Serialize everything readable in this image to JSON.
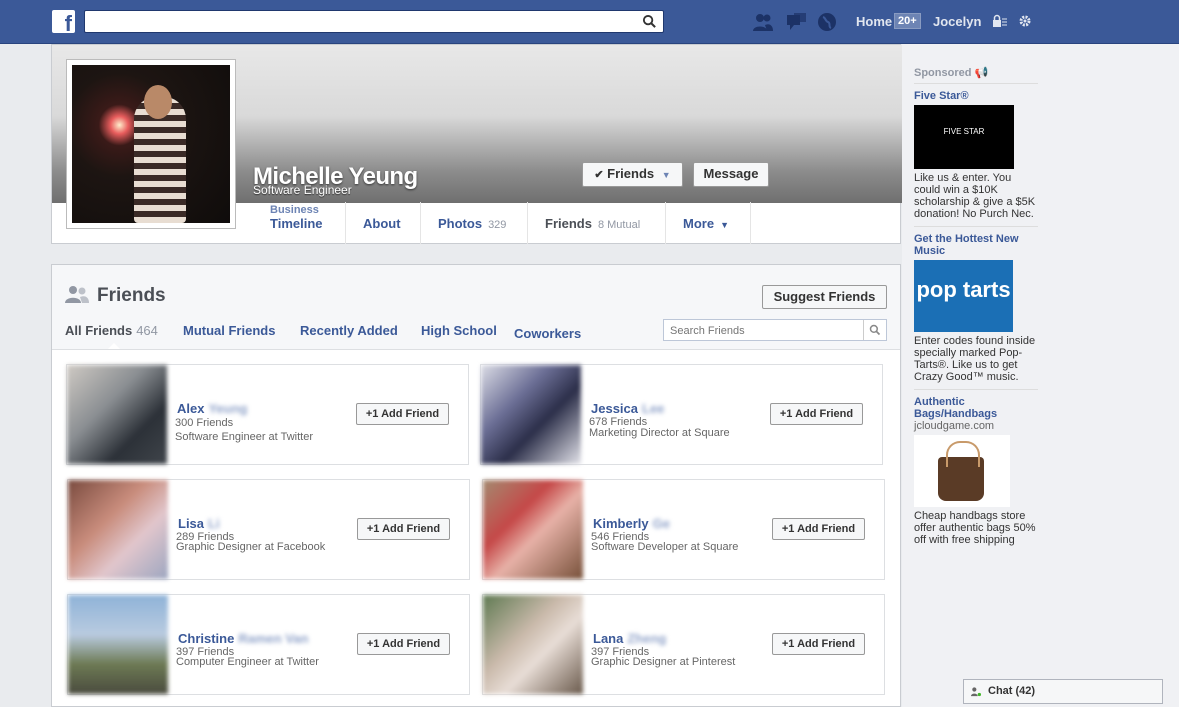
{
  "topbar": {
    "home_label": "Home",
    "home_count": "20+",
    "user_name": "Jocelyn"
  },
  "profile": {
    "name": "Michelle Yeung",
    "subtitle": "Software Engineer",
    "friends_btn": "Friends",
    "message_btn": "Message"
  },
  "tabs": [
    {
      "line1": "Business",
      "label": "Timeline",
      "count": ""
    },
    {
      "label": "About",
      "count": ""
    },
    {
      "label": "Photos",
      "count": "329"
    },
    {
      "label": "Friends",
      "count": "8 Mutual"
    },
    {
      "label": "More",
      "count": ""
    }
  ],
  "friends_section": {
    "title": "Friends",
    "suggest": "Suggest Friends",
    "search_placeholder": "Search Friends",
    "filters": [
      {
        "label": "All Friends",
        "count": "464"
      },
      {
        "label": "Mutual Friends",
        "count": ""
      },
      {
        "label": "Recently Added",
        "count": ""
      },
      {
        "label": "High School",
        "count": ""
      },
      {
        "label": "Coworkers",
        "count": ""
      }
    ]
  },
  "friends": [
    {
      "first": "Alex",
      "last": "Yeung",
      "count": "300 Friends",
      "desc": "Software Engineer at Twitter",
      "add": "Add Friend"
    },
    {
      "first": "Jessica",
      "last": "Lee",
      "count": "678 Friends",
      "desc": "Marketing Director at Square",
      "add": "Add Friend"
    },
    {
      "first": "Lisa",
      "last": "Li",
      "count": "289 Friends",
      "desc": "Graphic Designer at Facebook",
      "add": "Add Friend"
    },
    {
      "first": "Kimberly",
      "last": "Ge",
      "count": "546 Friends",
      "desc": "Software Developer at Square",
      "add": "Add Friend"
    },
    {
      "first": "Christine",
      "last": "Ramen Van",
      "count": "397 Friends",
      "desc": "Computer Engineer at Twitter",
      "add": "Add Friend"
    },
    {
      "first": "Lana",
      "last": "Zheng",
      "count": "397 Friends",
      "desc": "Graphic Designer at Pinterest",
      "add": "Add Friend"
    }
  ],
  "sidebar": {
    "sponsored": "Sponsored",
    "ads": [
      {
        "title": "Five Star®",
        "url": "",
        "body": "Like us & enter. You could win a $10K scholarship & give a $5K donation! No Purch Nec.",
        "image_text": "FIVE STAR"
      },
      {
        "title": "Get the Hottest New Music",
        "url": "",
        "body": "Enter codes found inside specially marked Pop-Tarts®. Like us to get Crazy Good™ music.",
        "image_text": "pop tarts"
      },
      {
        "title": "Authentic Bags/Handbags",
        "url": "jcloudgame.com",
        "body": "Cheap handbags store offer authentic bags 50% off with free shipping",
        "image_text": ""
      }
    ]
  },
  "chat": {
    "label": "Chat (42)"
  }
}
